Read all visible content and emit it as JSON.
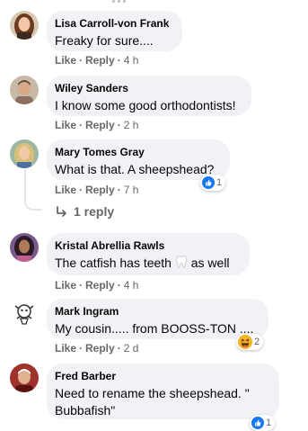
{
  "colors": {
    "bubble": "#f0f2f5",
    "meta": "#65676b",
    "like_blue": "#1877f2",
    "haha_yellow": "#f7b125"
  },
  "comments": [
    {
      "author": "Lisa Carroll-von Frank",
      "text": "Freaky for sure....",
      "like": "Like",
      "reply": "Reply",
      "time": "4 h",
      "avatar_icon": "avatar-woman-brown-hair"
    },
    {
      "author": "Wiley Sanders",
      "text": "I know some good orthodontists!",
      "like": "Like",
      "reply": "Reply",
      "time": "2 h",
      "avatar_icon": "avatar-man"
    },
    {
      "author": "Mary Tomes Gray",
      "text": "What is that. A sheepshead?",
      "like": "Like",
      "reply": "Reply",
      "time": "7 h",
      "avatar_icon": "avatar-woman-blonde",
      "reaction": {
        "icon": "like-icon",
        "count": "1"
      }
    },
    {
      "author": "Kristal Abrellia Rawls",
      "text_before": "The catfish has teeth",
      "emoji_icon": "tooth-emoji",
      "text_after": "as well",
      "like": "Like",
      "reply": "Reply",
      "time": "4 h",
      "avatar_icon": "avatar-woman-purple"
    },
    {
      "author": "Mark Ingram",
      "text": "My cousin..... from BOOSS-TON ....",
      "like": "Like",
      "reply": "Reply",
      "time": "2 d",
      "avatar_icon": "avatar-cartoon",
      "reaction": {
        "icon": "haha-icon",
        "count": "2"
      }
    },
    {
      "author": "Fred Barber",
      "text": "Need to rename the sheepshead. \" Bubbafish\"",
      "avatar_icon": "avatar-man-red",
      "reaction": {
        "icon": "like-icon",
        "count": "1"
      }
    }
  ],
  "replies_link": "1 reply"
}
